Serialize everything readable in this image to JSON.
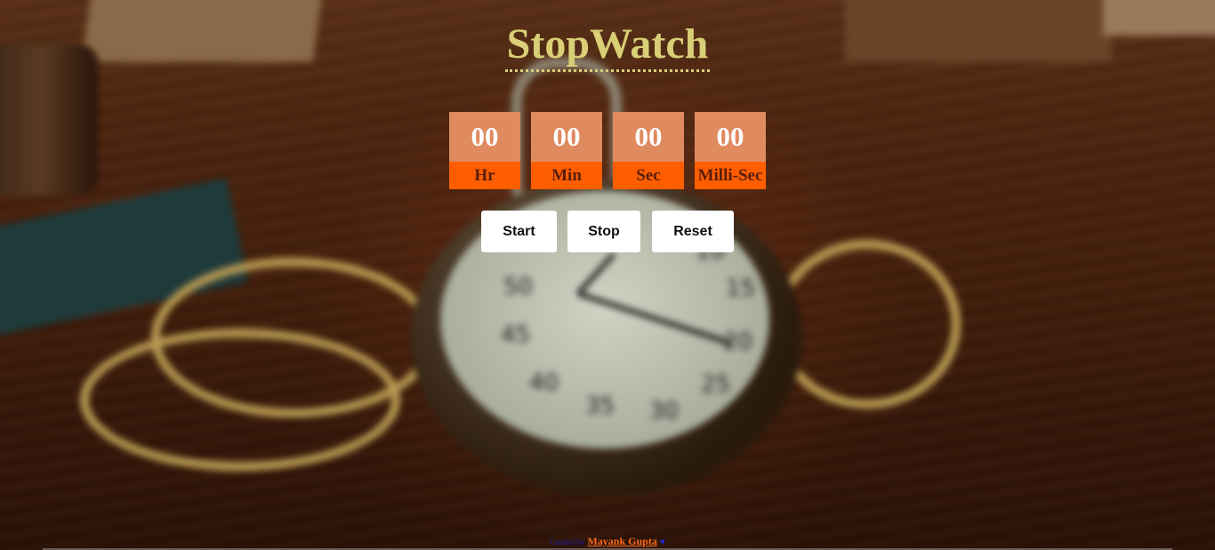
{
  "app": {
    "title": "StopWatch"
  },
  "timer": {
    "units": [
      {
        "value": "00",
        "label": "Hr"
      },
      {
        "value": "00",
        "label": "Min"
      },
      {
        "value": "00",
        "label": "Sec"
      },
      {
        "value": "00",
        "label": "Milli-Sec"
      }
    ]
  },
  "controls": {
    "start_label": "Start",
    "stop_label": "Stop",
    "reset_label": "Reset"
  },
  "footer": {
    "prefix": "Created by",
    "author": "Mayank Gupta",
    "heart": "♥"
  },
  "background": {
    "dial_numbers": [
      "50",
      "15",
      "45",
      "20",
      "40",
      "25",
      "35",
      "30",
      "10"
    ]
  },
  "colors": {
    "title": "#d8cf77",
    "digit_box": "#e08a5f",
    "label_box": "#ff5e00",
    "button_bg": "#ffffff",
    "author_link": "#ff6a1a"
  }
}
